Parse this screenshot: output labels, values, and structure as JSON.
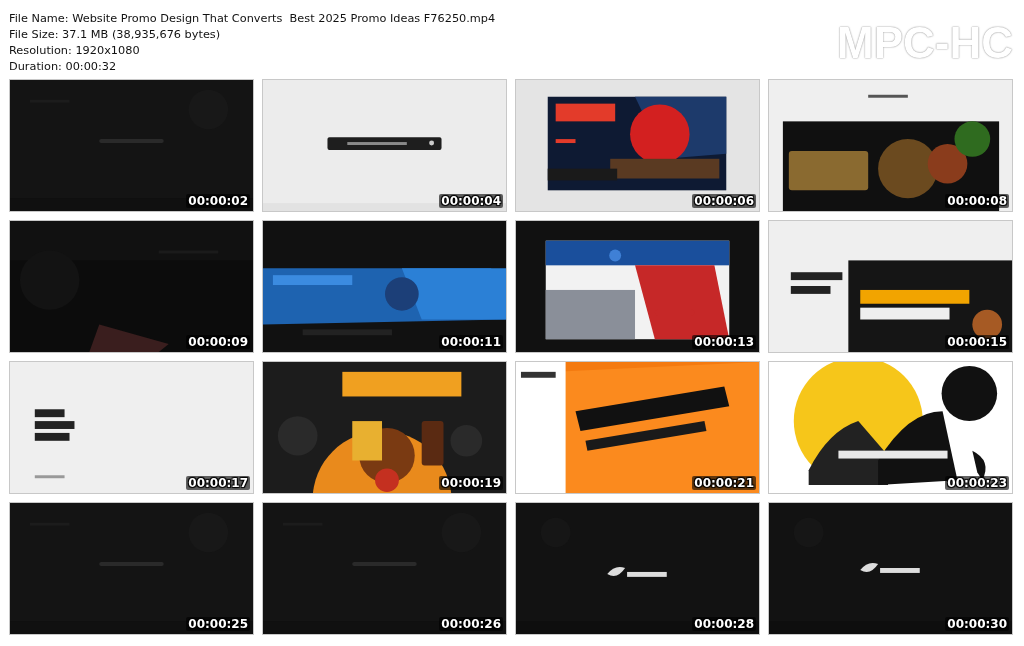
{
  "file_info": [
    "File Name: Website Promo Design That Converts  Best 2025 Promo Ideas F76250.mp4",
    "File Size: 37.1 MB (38,935,676 bytes)",
    "Resolution: 1920x1080",
    "Duration: 00:00:32"
  ],
  "logo": "MPC-HC",
  "thumbnails": [
    {
      "kind": "picture",
      "time": "00:00:02"
    },
    {
      "kind": "picture",
      "time": "00:00:04"
    },
    {
      "kind": "picture",
      "time": "00:00:06"
    },
    {
      "kind": "picture",
      "time": "00:00:08"
    },
    {
      "kind": "picture",
      "time": "00:00:09"
    },
    {
      "kind": "picture",
      "time": "00:00:11"
    },
    {
      "kind": "picture",
      "time": "00:00:13"
    },
    {
      "kind": "picture",
      "time": "00:00:15"
    },
    {
      "kind": "picture",
      "time": "00:00:17"
    },
    {
      "kind": "picture",
      "time": "00:00:19"
    },
    {
      "kind": "picture",
      "time": "00:00:21"
    },
    {
      "kind": "picture",
      "time": "00:00:23"
    },
    {
      "kind": "picture",
      "time": "00:00:25"
    },
    {
      "kind": "picture",
      "time": "00:00:26"
    },
    {
      "kind": "picture",
      "time": "00:00:28"
    },
    {
      "kind": "picture",
      "time": "00:00:30"
    }
  ]
}
